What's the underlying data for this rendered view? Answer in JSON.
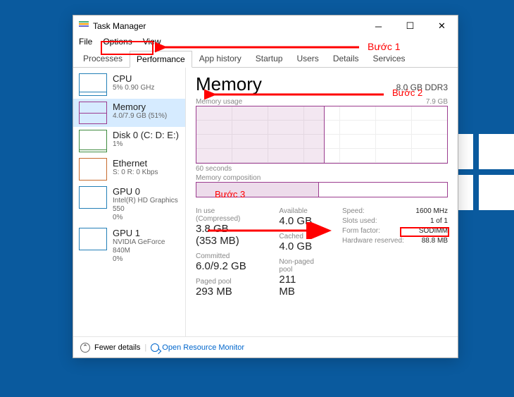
{
  "window_title": "Task Manager",
  "menu": {
    "file": "File",
    "options": "Options",
    "view": "View"
  },
  "tabs": {
    "processes": "Processes",
    "performance": "Performance",
    "app_history": "App history",
    "startup": "Startup",
    "users": "Users",
    "details": "Details",
    "services": "Services"
  },
  "sidebar": {
    "cpu": {
      "title": "CPU",
      "sub": "5% 0.90 GHz"
    },
    "memory": {
      "title": "Memory",
      "sub": "4.0/7.9 GB (51%)"
    },
    "disk": {
      "title": "Disk 0 (C: D: E:)",
      "sub": "1%"
    },
    "eth": {
      "title": "Ethernet",
      "sub": "S: 0 R: 0 Kbps"
    },
    "gpu0": {
      "title": "GPU 0",
      "sub1": "Intel(R) HD Graphics 550",
      "sub2": "0%"
    },
    "gpu1": {
      "title": "GPU 1",
      "sub1": "NVIDIA GeForce 840M",
      "sub2": "0%"
    }
  },
  "pane": {
    "title": "Memory",
    "total": "8.0 GB DDR3",
    "usage_label": "Memory usage",
    "usage_max": "7.9 GB",
    "time_label": "60 seconds",
    "comp_label": "Memory composition",
    "stats": {
      "inuse_label": "In use (Compressed)",
      "inuse_value": "3.8 GB (353 MB)",
      "available_label": "Available",
      "available_value": "4.0 GB",
      "committed_label": "Committed",
      "committed_value": "6.0/9.2 GB",
      "cached_label": "Cached",
      "cached_value": "4.0 GB",
      "paged_label": "Paged pool",
      "paged_value": "293 MB",
      "nonpaged_label": "Non-paged pool",
      "nonpaged_value": "211 MB"
    },
    "specs": {
      "speed_k": "Speed:",
      "speed_v": "1600 MHz",
      "slots_k": "Slots used:",
      "slots_v": "1 of 1",
      "form_k": "Form factor:",
      "form_v": "SODIMM",
      "hw_k": "Hardware reserved:",
      "hw_v": "88.8 MB"
    }
  },
  "footer": {
    "fewer": "Fewer details",
    "orm": "Open Resource Monitor"
  },
  "annotations": {
    "step1": "Bước 1",
    "step2": "Bước 2",
    "step3": "Bước 3"
  }
}
